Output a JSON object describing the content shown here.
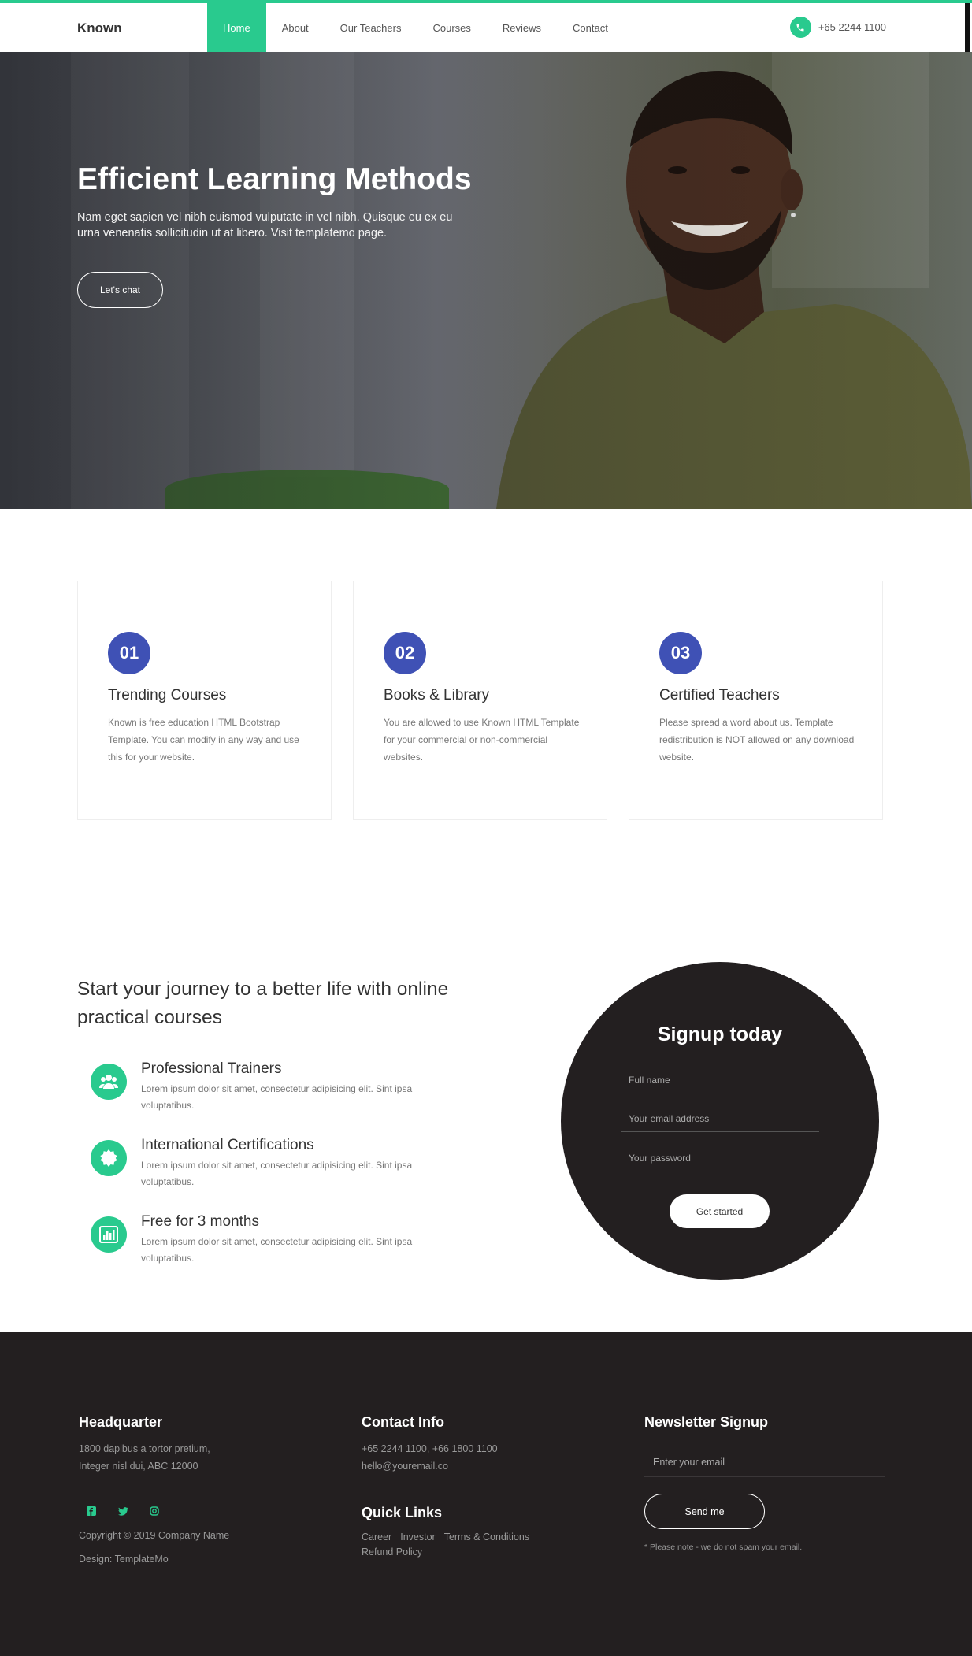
{
  "nav": {
    "brand": "Known",
    "items": [
      {
        "label": "Home",
        "active": true
      },
      {
        "label": "About"
      },
      {
        "label": "Our Teachers"
      },
      {
        "label": "Courses"
      },
      {
        "label": "Reviews"
      },
      {
        "label": "Contact"
      }
    ],
    "phone": "+65 2244 1100",
    "accent": "#29ca8e"
  },
  "hero": {
    "title": "Efficient Learning Methods",
    "subtitle": "Nam eget sapien vel nibh euismod vulputate in vel nibh. Quisque eu ex eu urna venenatis sollicitudin ut at libero. Visit templatemo page.",
    "button": "Let's chat"
  },
  "features": [
    {
      "num": "01",
      "title": "Trending Courses",
      "desc": "Known is free education HTML Bootstrap Template. You can modify in any way and use this for your website."
    },
    {
      "num": "02",
      "title": "Books & Library",
      "desc": "You are allowed to use Known HTML Template for your commercial or non-commercial websites."
    },
    {
      "num": "03",
      "title": "Certified Teachers",
      "desc": "Please spread a word about us. Template redistribution is NOT allowed on any download website."
    }
  ],
  "journey": {
    "title": "Start your journey to a better life with online practical courses",
    "perks": [
      {
        "icon": "users-icon",
        "title": "Professional Trainers",
        "desc": "Lorem ipsum dolor sit amet, consectetur adipisicing elit. Sint ipsa voluptatibus."
      },
      {
        "icon": "certificate-icon",
        "title": "International Certifications",
        "desc": "Lorem ipsum dolor sit amet, consectetur adipisicing elit. Sint ipsa voluptatibus."
      },
      {
        "icon": "bar-chart-icon",
        "title": "Free for 3 months",
        "desc": "Lorem ipsum dolor sit amet, consectetur adipisicing elit. Sint ipsa voluptatibus."
      }
    ]
  },
  "signup": {
    "title": "Signup today",
    "fullname_placeholder": "Full name",
    "email_placeholder": "Your email address",
    "password_placeholder": "Your password",
    "button": "Get started"
  },
  "footer": {
    "hq_title": "Headquarter",
    "hq_address_1": "1800 dapibus a tortor pretium,",
    "hq_address_2": "Integer nisl dui, ABC 12000",
    "social": [
      "facebook-icon",
      "twitter-icon",
      "instagram-icon"
    ],
    "copyright": "Copyright © 2019 Company Name",
    "design": "Design: TemplateMo",
    "contact_title": "Contact Info",
    "contact_phones": "+65 2244 1100, +66 1800 1100",
    "contact_email": "hello@youremail.co",
    "links_title": "Quick Links",
    "links": [
      "Career",
      "Investor",
      "Terms & Conditions",
      "Refund Policy"
    ],
    "newsletter_title": "Newsletter Signup",
    "newsletter_placeholder": "Enter your email",
    "newsletter_button": "Send me",
    "note": "* Please note - we do not spam your email."
  }
}
